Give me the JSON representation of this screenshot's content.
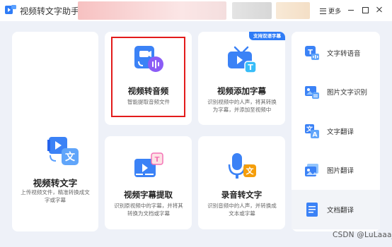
{
  "app": {
    "title": "视频转文字助手",
    "more_label": "更多"
  },
  "main_cards": {
    "video_to_text": {
      "title": "视频转文字",
      "desc": "上传视频文件，精准转换成文字或字幕"
    },
    "video_to_audio": {
      "title": "视频转音频",
      "desc": "智能提取音频文件"
    },
    "video_add_subtitle": {
      "title": "视频添加字幕",
      "badge": "支持双语字幕",
      "desc": "识别视频中的人声，将其转换为字幕，并添加至视频中"
    },
    "video_subtitle_extract": {
      "title": "视频字幕提取",
      "desc": "识别原视频中的字幕，并将其转换为文档或字幕"
    },
    "audio_to_text": {
      "title": "录音转文字",
      "desc": "识别音频中的人声，并转换成文本或字幕"
    }
  },
  "side_items": [
    {
      "label": "文字转语音",
      "icon": "text-to-speech-icon"
    },
    {
      "label": "图片文字识别",
      "icon": "image-ocr-icon"
    },
    {
      "label": "文字翻译",
      "icon": "text-translate-icon"
    },
    {
      "label": "图片翻译",
      "icon": "image-translate-icon"
    },
    {
      "label": "文档翻译",
      "icon": "document-translate-icon"
    }
  ],
  "watermark": "CSDN @LuLaaa_",
  "colors": {
    "accent": "#2f7cf6",
    "highlight": "#e31b1b",
    "background": "#eef1f8"
  }
}
